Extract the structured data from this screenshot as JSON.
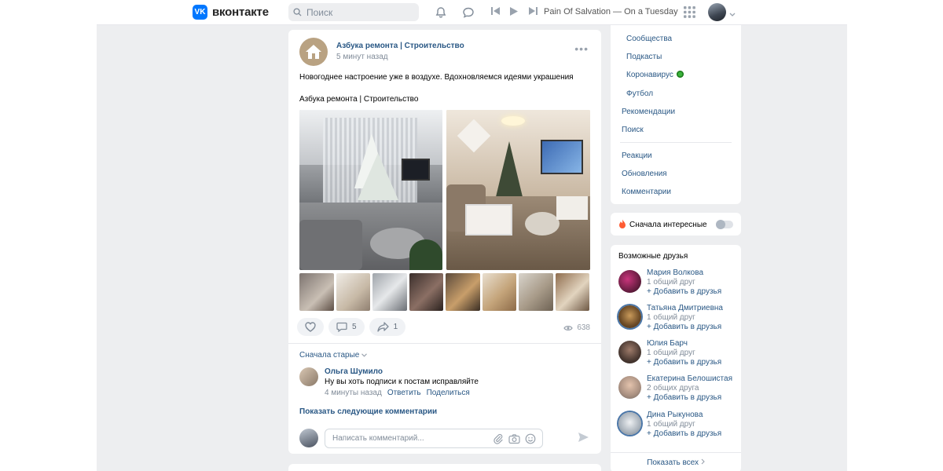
{
  "header": {
    "logo_text": "вконтакте",
    "logo_mark": "VK",
    "search_placeholder": "Поиск",
    "now_playing": "Pain Of Salvation — On a Tuesday"
  },
  "post": {
    "group_name": "Азбука ремонта | Строительство",
    "time": "5 минут назад",
    "text": "Новогоднее настроение уже в воздухе. Вдохновляемся идеями украшения",
    "signature": "Азбука ремонта | Строительство",
    "comments_count": "5",
    "shares_count": "1",
    "views": "638",
    "sort_label": "Сначала старые",
    "comment": {
      "author": "Ольга Шумило",
      "text": "Ну вы хоть подписи к постам исправляйте",
      "time": "4 минуты назад",
      "reply": "Ответить",
      "share": "Поделиться"
    },
    "more_comments": "Показать следующие комментарии",
    "comment_placeholder": "Написать комментарий..."
  },
  "menu": {
    "items": [
      "Сообщества",
      "Подкасты",
      "Коронавирус",
      "Футбол"
    ],
    "links": [
      "Рекомендации",
      "Поиск"
    ],
    "links2": [
      "Реакции",
      "Обновления",
      "Комментарии"
    ]
  },
  "interesting": {
    "label": "Сначала интересные",
    "enabled": false
  },
  "friends": {
    "title": "Возможные друзья",
    "add_label": "+ Добавить в друзья",
    "show_all": "Показать всех",
    "list": [
      {
        "name": "Мария Волкова",
        "mutual": "1 общий друг"
      },
      {
        "name": "Татьяна Дмитриевна",
        "mutual": "1 общий друг"
      },
      {
        "name": "Юлия Барч",
        "mutual": "1 общий друг"
      },
      {
        "name": "Екатерина Белошистая",
        "mutual": "2 общих друга"
      },
      {
        "name": "Дина Рыкунова",
        "mutual": "1 общий друг"
      }
    ]
  },
  "colors": {
    "accent": "#0077ff",
    "link": "#2a5885",
    "background": "#edeef0"
  }
}
